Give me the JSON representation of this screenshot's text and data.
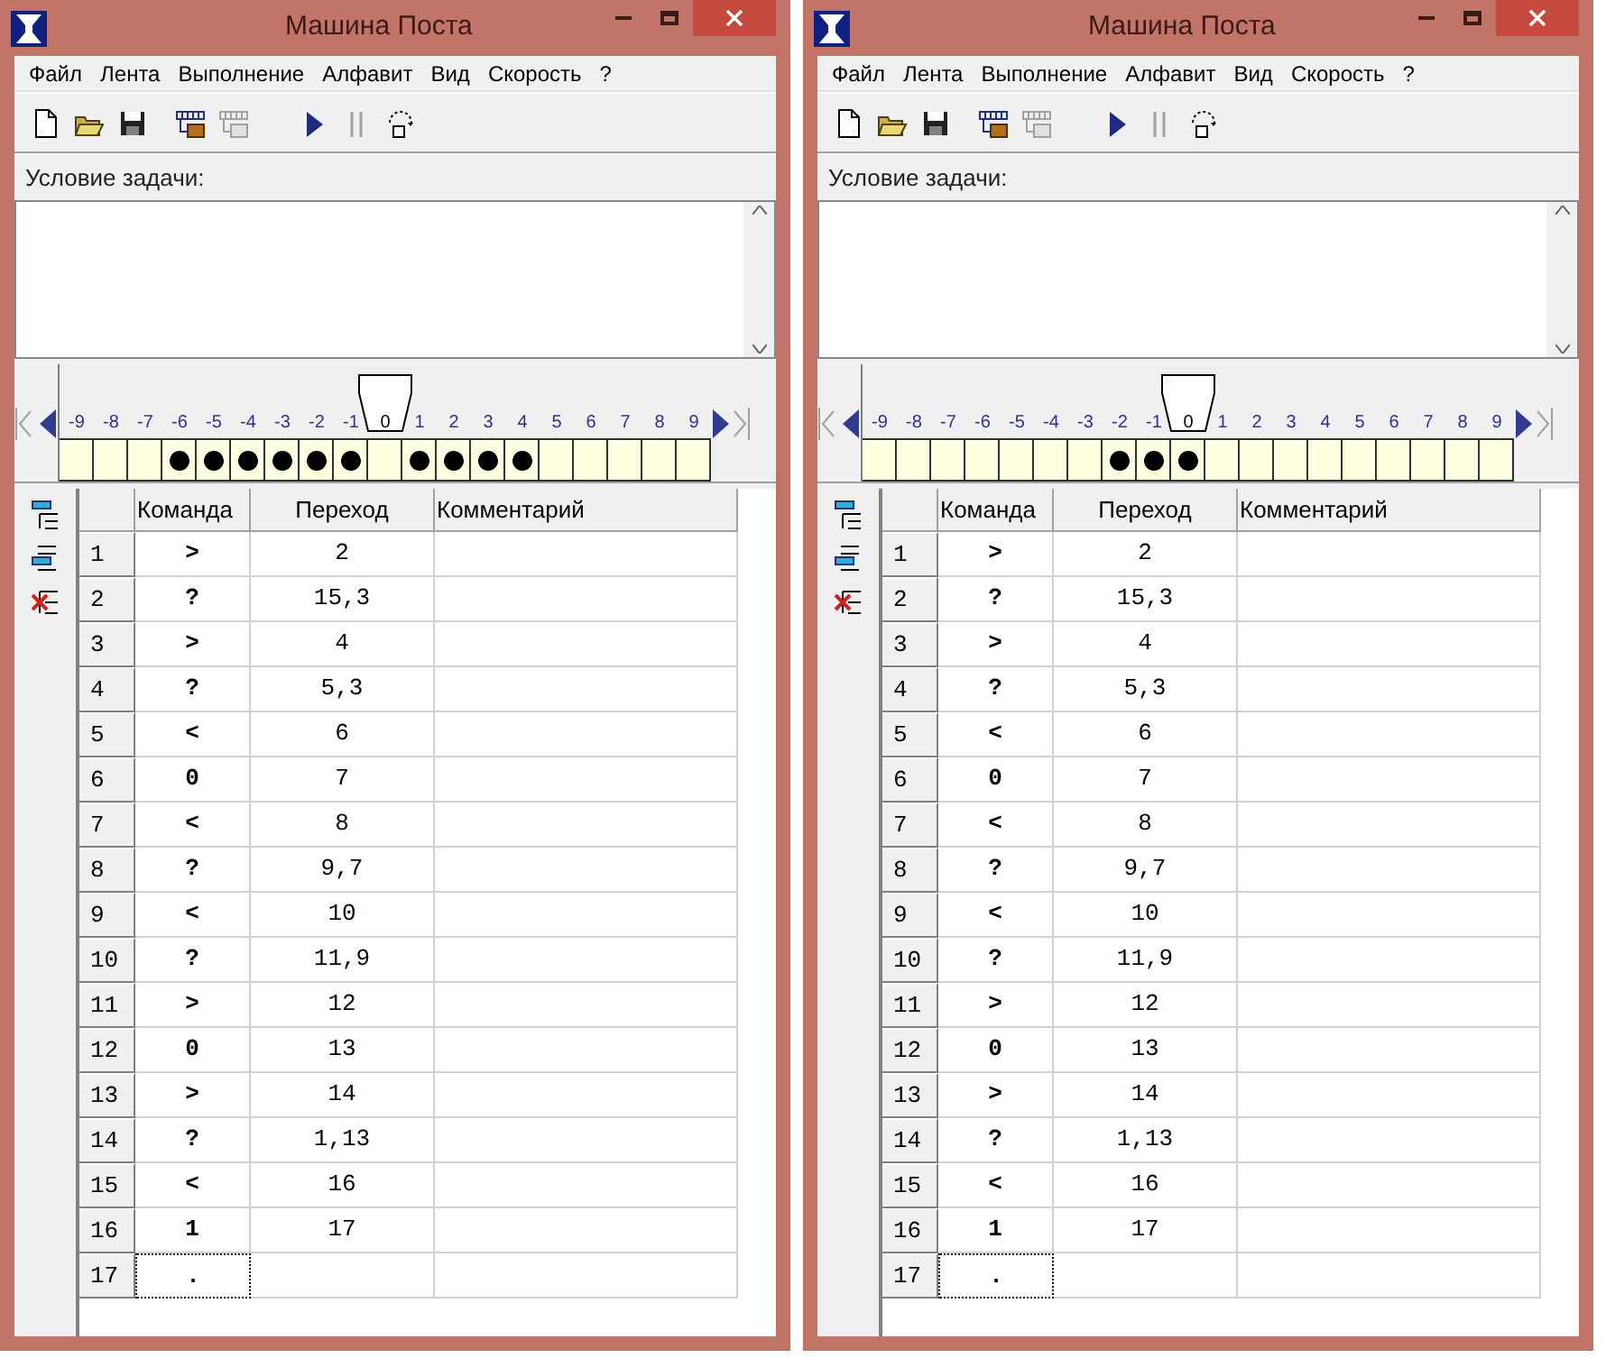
{
  "windows": [
    {
      "title": "Машина Поста",
      "menu": [
        "Файл",
        "Лента",
        "Выполнение",
        "Алфавит",
        "Вид",
        "Скорость",
        "?"
      ],
      "toolbar": [
        {
          "kind": "new",
          "disabled": false
        },
        {
          "kind": "open",
          "disabled": false
        },
        {
          "kind": "save",
          "disabled": false
        },
        {
          "kind": "tape",
          "disabled": false
        },
        {
          "kind": "tape",
          "disabled": true
        },
        {
          "kind": "run",
          "disabled": false
        },
        {
          "kind": "pause",
          "disabled": true
        },
        {
          "kind": "step",
          "disabled": false
        }
      ],
      "condition_label": "Условие задачи:",
      "tape": [
        {
          "label": "-9",
          "marked": false,
          "selected": false
        },
        {
          "label": "-8",
          "marked": false,
          "selected": false
        },
        {
          "label": "-7",
          "marked": false,
          "selected": false
        },
        {
          "label": "-6",
          "marked": true,
          "selected": false
        },
        {
          "label": "-5",
          "marked": true,
          "selected": false
        },
        {
          "label": "-4",
          "marked": true,
          "selected": false
        },
        {
          "label": "-3",
          "marked": true,
          "selected": false
        },
        {
          "label": "-2",
          "marked": true,
          "selected": false
        },
        {
          "label": "-1",
          "marked": true,
          "selected": false
        },
        {
          "label": "0",
          "marked": false,
          "selected": true
        },
        {
          "label": "1",
          "marked": true,
          "selected": false
        },
        {
          "label": "2",
          "marked": true,
          "selected": false
        },
        {
          "label": "3",
          "marked": true,
          "selected": false
        },
        {
          "label": "4",
          "marked": true,
          "selected": false
        },
        {
          "label": "5",
          "marked": false,
          "selected": false
        },
        {
          "label": "6",
          "marked": false,
          "selected": false
        },
        {
          "label": "7",
          "marked": false,
          "selected": false
        },
        {
          "label": "8",
          "marked": false,
          "selected": false
        },
        {
          "label": "9",
          "marked": false,
          "selected": false
        }
      ],
      "table": {
        "columns": [
          "Команда",
          "Переход",
          "Комментарий"
        ],
        "rows": [
          {
            "num": "1",
            "command": ">",
            "jump": "2",
            "selected": false
          },
          {
            "num": "2",
            "command": "?",
            "jump": "15,3",
            "selected": false
          },
          {
            "num": "3",
            "command": ">",
            "jump": "4",
            "selected": false
          },
          {
            "num": "4",
            "command": "?",
            "jump": "5,3",
            "selected": false
          },
          {
            "num": "5",
            "command": "<",
            "jump": "6",
            "selected": false
          },
          {
            "num": "6",
            "command": "0",
            "jump": "7",
            "selected": false
          },
          {
            "num": "7",
            "command": "<",
            "jump": "8",
            "selected": false
          },
          {
            "num": "8",
            "command": "?",
            "jump": "9,7",
            "selected": false
          },
          {
            "num": "9",
            "command": "<",
            "jump": "10",
            "selected": false
          },
          {
            "num": "10",
            "command": "?",
            "jump": "11,9",
            "selected": false
          },
          {
            "num": "11",
            "command": ">",
            "jump": "12",
            "selected": false
          },
          {
            "num": "12",
            "command": "0",
            "jump": "13",
            "selected": false
          },
          {
            "num": "13",
            "command": ">",
            "jump": "14",
            "selected": false
          },
          {
            "num": "14",
            "command": "?",
            "jump": "1,13",
            "selected": false
          },
          {
            "num": "15",
            "command": "<",
            "jump": "16",
            "selected": false
          },
          {
            "num": "16",
            "command": "1",
            "jump": "17",
            "selected": false
          },
          {
            "num": "17",
            "command": ".",
            "jump": "",
            "selected": true
          }
        ]
      }
    },
    {
      "title": "Машина Поста",
      "menu": [
        "Файл",
        "Лента",
        "Выполнение",
        "Алфавит",
        "Вид",
        "Скорость",
        "?"
      ],
      "toolbar": [
        {
          "kind": "new",
          "disabled": false
        },
        {
          "kind": "open",
          "disabled": false
        },
        {
          "kind": "save",
          "disabled": false
        },
        {
          "kind": "tape",
          "disabled": false
        },
        {
          "kind": "tape",
          "disabled": true
        },
        {
          "kind": "run",
          "disabled": false
        },
        {
          "kind": "pause",
          "disabled": true
        },
        {
          "kind": "step",
          "disabled": false
        }
      ],
      "condition_label": "Условие задачи:",
      "tape": [
        {
          "label": "-9",
          "marked": false,
          "selected": false
        },
        {
          "label": "-8",
          "marked": false,
          "selected": false
        },
        {
          "label": "-7",
          "marked": false,
          "selected": false
        },
        {
          "label": "-6",
          "marked": false,
          "selected": false
        },
        {
          "label": "-5",
          "marked": false,
          "selected": false
        },
        {
          "label": "-4",
          "marked": false,
          "selected": false
        },
        {
          "label": "-3",
          "marked": false,
          "selected": false
        },
        {
          "label": "-2",
          "marked": true,
          "selected": false
        },
        {
          "label": "-1",
          "marked": true,
          "selected": false
        },
        {
          "label": "0",
          "marked": true,
          "selected": true
        },
        {
          "label": "1",
          "marked": false,
          "selected": false
        },
        {
          "label": "2",
          "marked": false,
          "selected": false
        },
        {
          "label": "3",
          "marked": false,
          "selected": false
        },
        {
          "label": "4",
          "marked": false,
          "selected": false
        },
        {
          "label": "5",
          "marked": false,
          "selected": false
        },
        {
          "label": "6",
          "marked": false,
          "selected": false
        },
        {
          "label": "7",
          "marked": false,
          "selected": false
        },
        {
          "label": "8",
          "marked": false,
          "selected": false
        },
        {
          "label": "9",
          "marked": false,
          "selected": false
        }
      ],
      "table": {
        "columns": [
          "Команда",
          "Переход",
          "Комментарий"
        ],
        "rows": [
          {
            "num": "1",
            "command": ">",
            "jump": "2",
            "selected": false
          },
          {
            "num": "2",
            "command": "?",
            "jump": "15,3",
            "selected": false
          },
          {
            "num": "3",
            "command": ">",
            "jump": "4",
            "selected": false
          },
          {
            "num": "4",
            "command": "?",
            "jump": "5,3",
            "selected": false
          },
          {
            "num": "5",
            "command": "<",
            "jump": "6",
            "selected": false
          },
          {
            "num": "6",
            "command": "0",
            "jump": "7",
            "selected": false
          },
          {
            "num": "7",
            "command": "<",
            "jump": "8",
            "selected": false
          },
          {
            "num": "8",
            "command": "?",
            "jump": "9,7",
            "selected": false
          },
          {
            "num": "9",
            "command": "<",
            "jump": "10",
            "selected": false
          },
          {
            "num": "10",
            "command": "?",
            "jump": "11,9",
            "selected": false
          },
          {
            "num": "11",
            "command": ">",
            "jump": "12",
            "selected": false
          },
          {
            "num": "12",
            "command": "0",
            "jump": "13",
            "selected": false
          },
          {
            "num": "13",
            "command": ">",
            "jump": "14",
            "selected": false
          },
          {
            "num": "14",
            "command": "?",
            "jump": "1,13",
            "selected": false
          },
          {
            "num": "15",
            "command": "<",
            "jump": "16",
            "selected": false
          },
          {
            "num": "16",
            "command": "1",
            "jump": "17",
            "selected": false
          },
          {
            "num": "17",
            "command": ".",
            "jump": "",
            "selected": true
          }
        ]
      }
    }
  ]
}
